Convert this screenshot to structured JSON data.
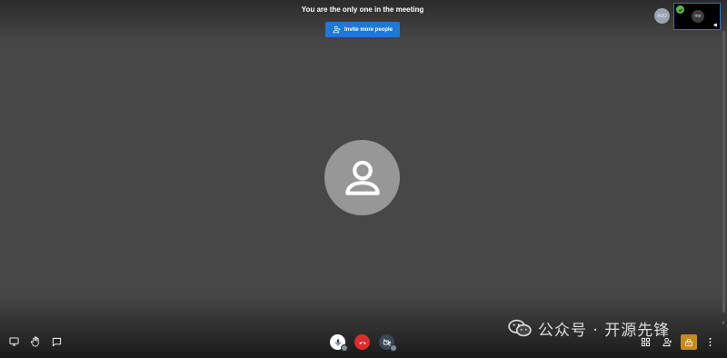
{
  "meeting": {
    "notice": "You are the only one in the meeting",
    "invite_label": "Invite more people"
  },
  "participants": {
    "remote_initials": "AUD",
    "self_initials": "me"
  },
  "watermark": {
    "text": "公众号 · 开源先锋"
  },
  "icons": {
    "toolbar_left": [
      "screen-share-icon",
      "raise-hand-icon",
      "chat-icon"
    ],
    "toolbar_center": [
      "microphone-icon",
      "hang-up-icon",
      "camera-off-icon"
    ],
    "toolbar_right": [
      "tile-view-icon",
      "invite-people-icon",
      "security-lock-icon",
      "more-options-icon"
    ]
  },
  "colors": {
    "background": "#474747",
    "invite_button": "#1f78d6",
    "hangup": "#dd2c2c",
    "security": "#c58a20",
    "self_check": "#5fb24a"
  }
}
